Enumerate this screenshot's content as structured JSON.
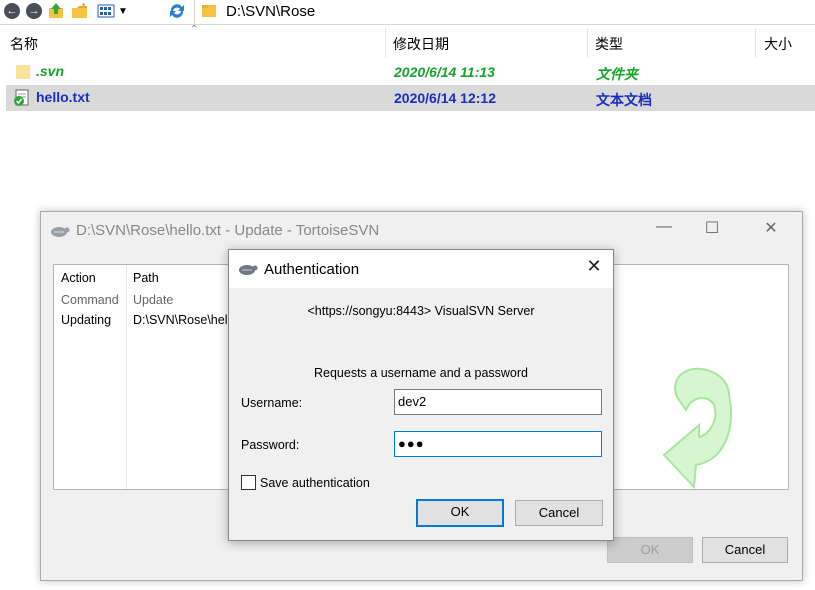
{
  "explorer": {
    "address": "D:\\SVN\\Rose",
    "columns": {
      "name": "名称",
      "modified": "修改日期",
      "type": "类型",
      "size": "大小"
    },
    "files": [
      {
        "name": ".svn",
        "modified": "2020/6/14 11:13",
        "type": "文件夹",
        "icon": "folder-icon"
      },
      {
        "name": "hello.txt",
        "modified": "2020/6/14 12:12",
        "type": "文本文档",
        "icon": "svn-text-file-icon"
      }
    ]
  },
  "update_dialog": {
    "title": "D:\\SVN\\Rose\\hello.txt - Update - TortoiseSVN",
    "columns": {
      "action": "Action",
      "path": "Path"
    },
    "rows": [
      {
        "action": "Command",
        "path": "Update"
      },
      {
        "action": "Updating",
        "path": "D:\\SVN\\Rose\\hel"
      }
    ],
    "ok_label": "OK",
    "cancel_label": "Cancel"
  },
  "auth_dialog": {
    "title": "Authentication",
    "realm": "<https://songyu:8443> VisualSVN Server",
    "prompt": "Requests a username and a password",
    "username_label": "Username:",
    "username_value": "dev2",
    "password_label": "Password:",
    "password_value": "●●●",
    "save_label": "Save authentication",
    "ok_label": "OK",
    "cancel_label": "Cancel"
  },
  "colors": {
    "svn_green": "#16a52c",
    "selected_blue": "#1a2fbf",
    "focus_blue": "#0078d7"
  }
}
